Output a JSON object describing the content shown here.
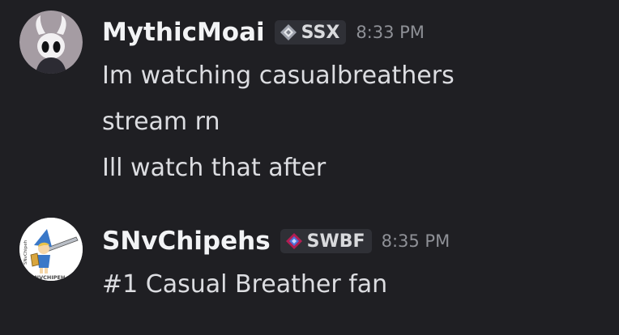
{
  "messages": [
    {
      "author": "MythicMoai",
      "tag": "SSX",
      "timestamp": "8:33 PM",
      "avatar_icon": "hollow-knight-icon",
      "lines": [
        "Im watching casualbreathers",
        "stream rn",
        "Ill watch that after"
      ]
    },
    {
      "author": "SNvChipehs",
      "tag": "SWBF",
      "timestamp": "8:35 PM",
      "avatar_icon": "cartoon-knight-icon",
      "avatar_text": "SNVCHIPEH",
      "avatar_side_text": "SNvChipeh",
      "lines": [
        "#1 Casual Breather fan"
      ]
    }
  ],
  "colors": {
    "background": "#1f1f23",
    "author": "#f2f3f5",
    "text": "#dcdde1",
    "timestamp": "#8e9096",
    "tag_bg": "#2f3036"
  }
}
